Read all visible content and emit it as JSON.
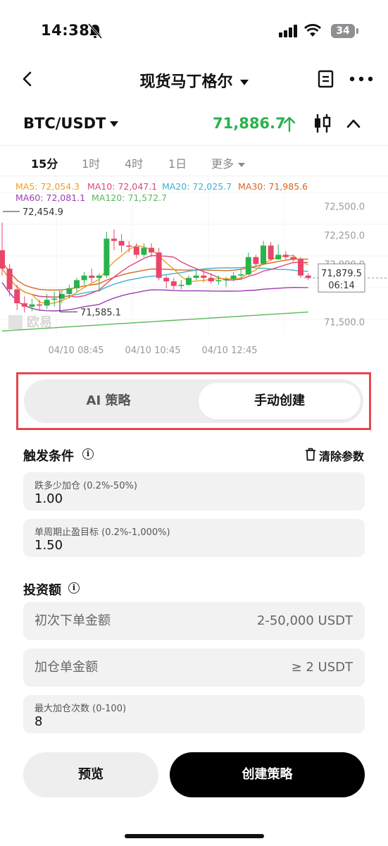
{
  "status_bar": {
    "time": "14:38",
    "battery": "34"
  },
  "nav": {
    "title": "现货马丁格尔"
  },
  "pair": {
    "symbol": "BTC/USDT",
    "price": "71,886.7",
    "price_color": "#2bb24c"
  },
  "timeframes": {
    "items": [
      "15分",
      "1时",
      "4时",
      "1日"
    ],
    "more": "更多",
    "active": "15分"
  },
  "chart_data": {
    "type": "candlestick",
    "ma_legend": [
      {
        "label": "MA5: 72,054.3",
        "color": "#f0a020"
      },
      {
        "label": "MA10: 72,047.1",
        "color": "#e0457b"
      },
      {
        "label": "MA20: 72,025.7",
        "color": "#3bb3d0"
      },
      {
        "label": "MA30: 71,985.6",
        "color": "#d9661f"
      },
      {
        "label": "MA60: 72,081.1",
        "color": "#9b3fb0"
      },
      {
        "label": "MA120: 71,572.7",
        "color": "#5cb85c"
      }
    ],
    "y_ticks": [
      "72,500.0",
      "72,250.0",
      "72,000.0",
      "71,500.0"
    ],
    "y_range": [
      71380,
      72620
    ],
    "x_ticks": [
      "04/10 08:45",
      "04/10 10:45",
      "04/10 12:45"
    ],
    "high_label": "72,454.9",
    "low_label": "71,585.1",
    "current_price": "71,879.5",
    "countdown": "06:14",
    "watermark": "欧易",
    "candles": [
      [
        72120,
        71960,
        72360,
        71900
      ],
      [
        71960,
        71780,
        72000,
        71720
      ],
      [
        71780,
        71660,
        71820,
        71600
      ],
      [
        71660,
        71630,
        71720,
        71580
      ],
      [
        71630,
        71650,
        71700,
        71590
      ],
      [
        71650,
        71640,
        71690,
        71600
      ],
      [
        71640,
        71690,
        71740,
        71610
      ],
      [
        71690,
        71700,
        71760,
        71630
      ],
      [
        71700,
        71740,
        71780,
        71660
      ],
      [
        71740,
        71790,
        71820,
        71700
      ],
      [
        71790,
        71860,
        71880,
        71760
      ],
      [
        71860,
        71900,
        71930,
        71820
      ],
      [
        71900,
        71880,
        71960,
        71840
      ],
      [
        71880,
        71900,
        71920,
        71760
      ],
      [
        71900,
        72220,
        72280,
        71880
      ],
      [
        72220,
        72200,
        72300,
        72120
      ],
      [
        72200,
        72160,
        72260,
        72100
      ],
      [
        72160,
        72150,
        72200,
        72100
      ],
      [
        72150,
        72080,
        72180,
        72050
      ],
      [
        72080,
        72140,
        72180,
        72060
      ],
      [
        72140,
        72100,
        72180,
        72060
      ],
      [
        72100,
        71880,
        72140,
        71860
      ],
      [
        71880,
        71850,
        71900,
        71790
      ],
      [
        71850,
        71810,
        71880,
        71780
      ],
      [
        71810,
        71820,
        71860,
        71780
      ],
      [
        71820,
        71880,
        71900,
        71810
      ],
      [
        71880,
        71900,
        71960,
        71860
      ],
      [
        71900,
        71880,
        71940,
        71840
      ],
      [
        71880,
        71850,
        71920,
        71830
      ],
      [
        71850,
        71860,
        71900,
        71820
      ],
      [
        71860,
        71870,
        71890,
        71800
      ],
      [
        71870,
        71900,
        71930,
        71850
      ],
      [
        71900,
        71910,
        71960,
        71870
      ],
      [
        71910,
        72060,
        72100,
        71900
      ],
      [
        72060,
        72000,
        72080,
        71980
      ],
      [
        72000,
        72160,
        72200,
        71990
      ],
      [
        72160,
        72040,
        72190,
        72030
      ],
      [
        72040,
        72080,
        72170,
        72040
      ],
      [
        72080,
        72060,
        72110,
        72040
      ],
      [
        72060,
        72040,
        72080,
        72020
      ],
      [
        72040,
        71900,
        72060,
        71880
      ],
      [
        71900,
        71880,
        71920,
        71860
      ]
    ]
  },
  "tabs": {
    "ai": "AI 策略",
    "manual": "手动创建"
  },
  "trigger": {
    "title": "触发条件",
    "clear": "清除参数",
    "drop_label": "跌多少加仓 (0.2%-50%)",
    "drop_value": "1.00",
    "tp_label": "单周期止盈目标 (0.2%-1,000%)",
    "tp_value": "1.50"
  },
  "invest": {
    "title": "投资额",
    "initial_placeholder": "初次下单金额",
    "initial_hint": "2-50,000 USDT",
    "add_placeholder": "加仓单金额",
    "add_hint": "≥ 2 USDT",
    "max_label": "最大加仓次数 (0-100)",
    "max_value": "8"
  },
  "actions": {
    "preview": "预览",
    "create": "创建策略"
  }
}
